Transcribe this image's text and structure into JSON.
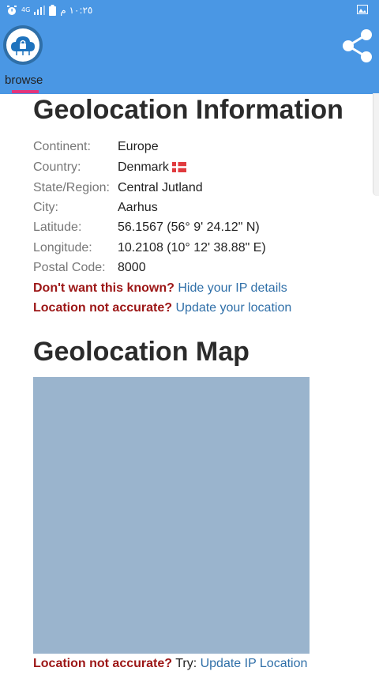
{
  "status_bar": {
    "time": "١٠:٢٥ م",
    "network": "4G"
  },
  "app_bar": {
    "tab_label": "browse"
  },
  "info": {
    "title": "Geolocation Information",
    "rows": [
      {
        "label": "Continent:",
        "value": "Europe"
      },
      {
        "label": "Country:",
        "value": "Denmark"
      },
      {
        "label": "State/Region:",
        "value": "Central Jutland"
      },
      {
        "label": "City:",
        "value": "Aarhus"
      },
      {
        "label": "Latitude:",
        "value": "56.1567  (56° 9' 24.12\" N)"
      },
      {
        "label": "Longitude:",
        "value": "10.2108  (10° 12' 38.88\" E)"
      },
      {
        "label": "Postal Code:",
        "value": "8000"
      }
    ],
    "hide_prompt": "Don't want this known?",
    "hide_link": "Hide your IP details",
    "update_prompt": "Location not accurate?",
    "update_link": "Update your location"
  },
  "map": {
    "title": "Geolocation Map",
    "footer_prompt": "Location not accurate?",
    "footer_try": "Try:",
    "footer_link": "Update IP Location"
  },
  "colors": {
    "header": "#4a97e4",
    "accent": "#e5347a",
    "link": "#2f6fa8",
    "warning": "#9c1616",
    "map_bg": "#9ab4cd"
  },
  "icons": [
    "alarm-icon",
    "signal-icon",
    "battery-icon",
    "image-icon",
    "cloud-lock-icon",
    "share-icon",
    "denmark-flag-icon"
  ]
}
